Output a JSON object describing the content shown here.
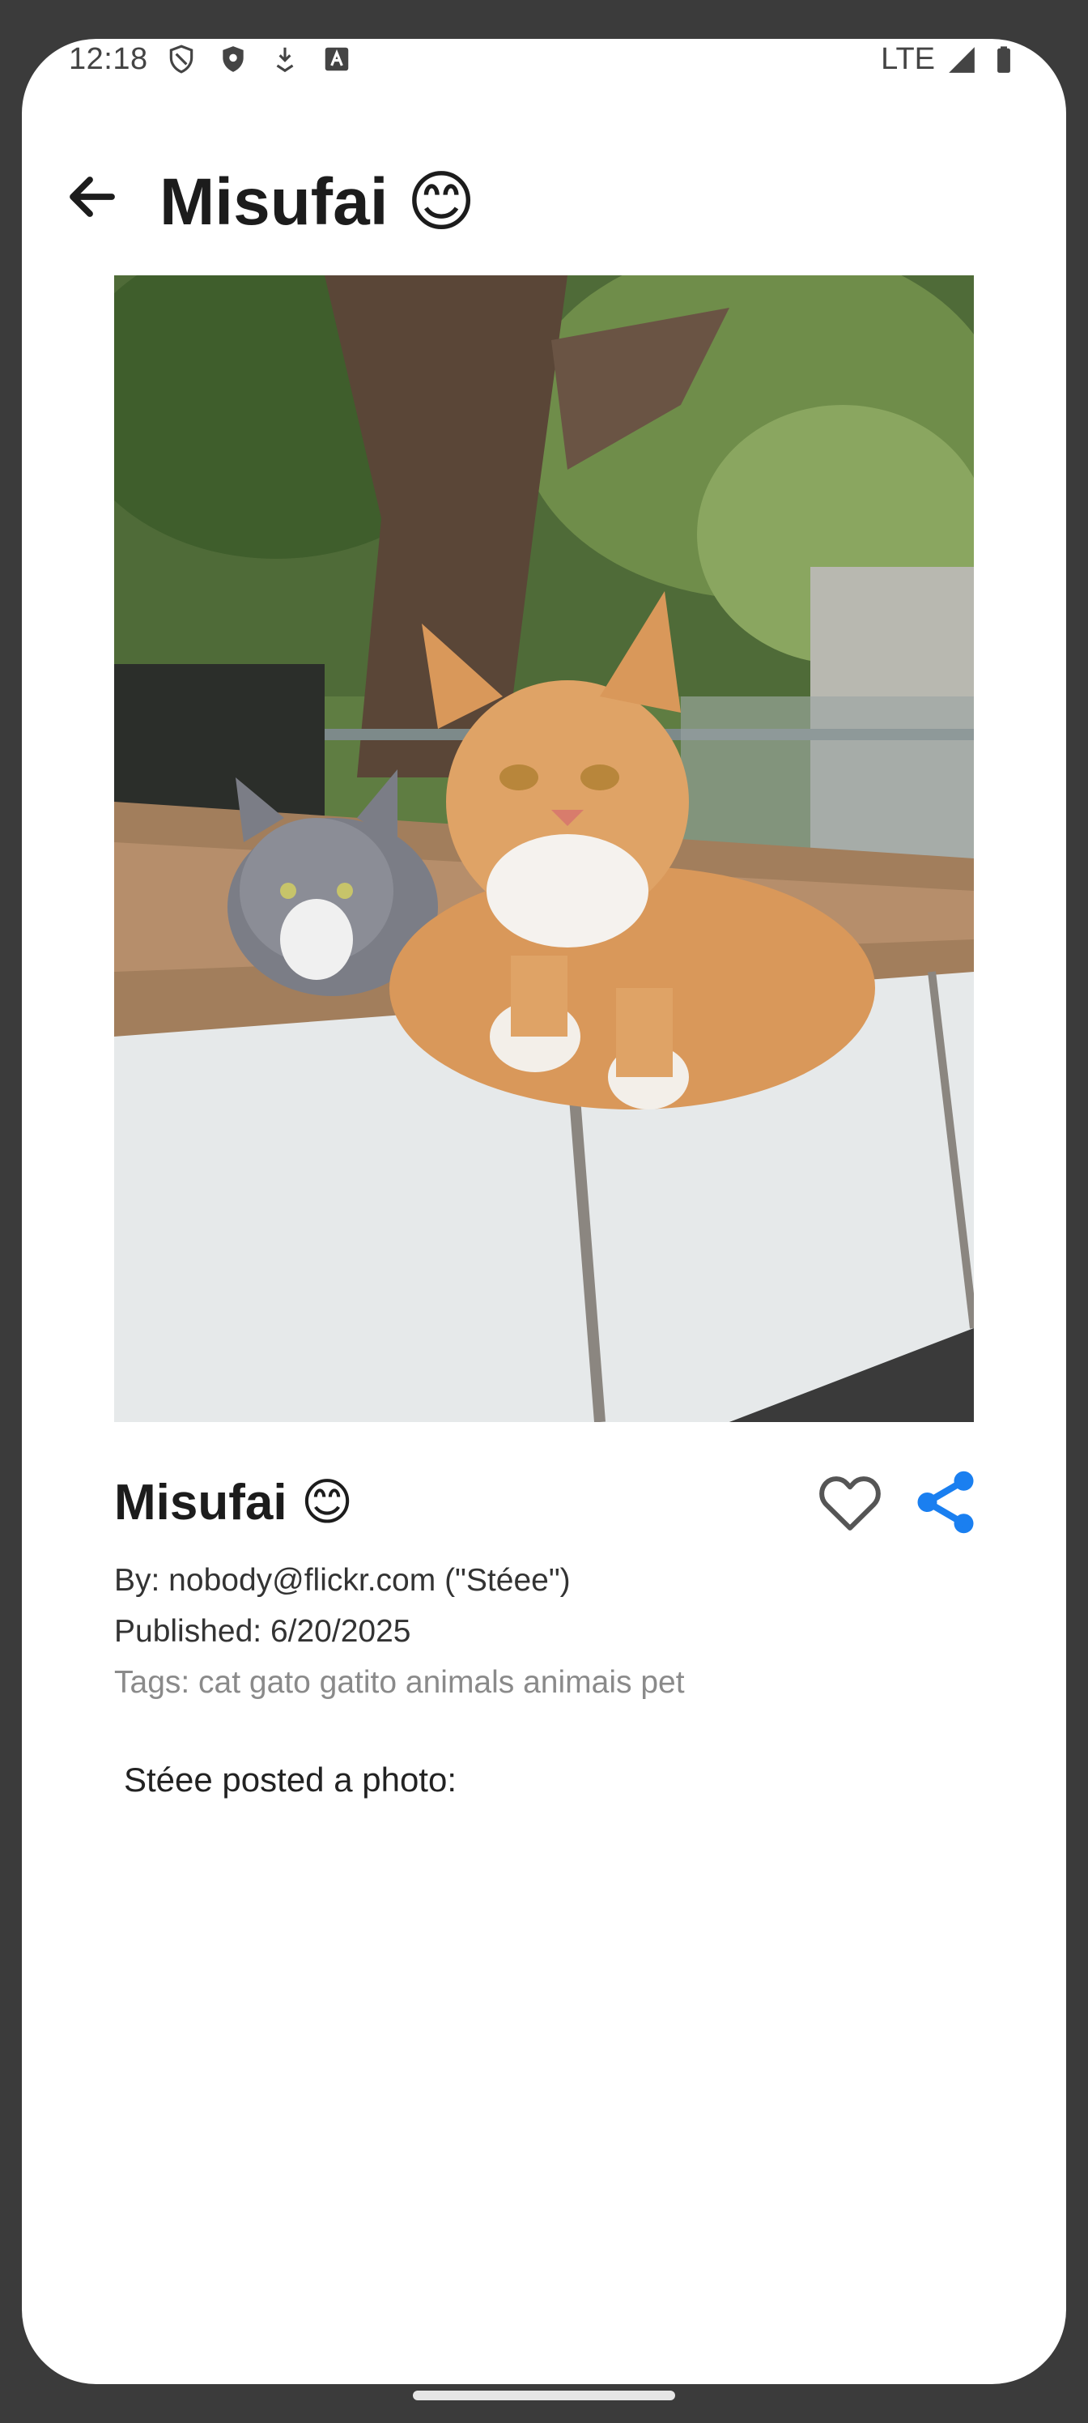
{
  "status_bar": {
    "time": "12:18",
    "network": "LTE",
    "icons": [
      "shield-outline-icon",
      "shield-filled-icon",
      "download-icon",
      "font-icon",
      "signal-icon",
      "battery-icon"
    ]
  },
  "app_bar": {
    "back_icon": "arrow-back-icon",
    "title": "Misufai 😊"
  },
  "photo": {
    "subject": "cats-photo"
  },
  "details": {
    "title": "Misufai 😊",
    "author": "By: nobody@flickr.com (\"Stéee\")",
    "published": "Published: 6/20/2025",
    "tags": "Tags: cat gato gatito animals animais pet",
    "description": "Stéee posted a photo:"
  },
  "actions": {
    "favorite_icon": "heart-outline-icon",
    "share_icon": "share-icon"
  },
  "colors": {
    "accent": "#1a7ff0",
    "text_primary": "#1c1c1c",
    "text_secondary": "#333333",
    "text_muted": "#8a8a8a",
    "frame": "#3b3b3b"
  }
}
